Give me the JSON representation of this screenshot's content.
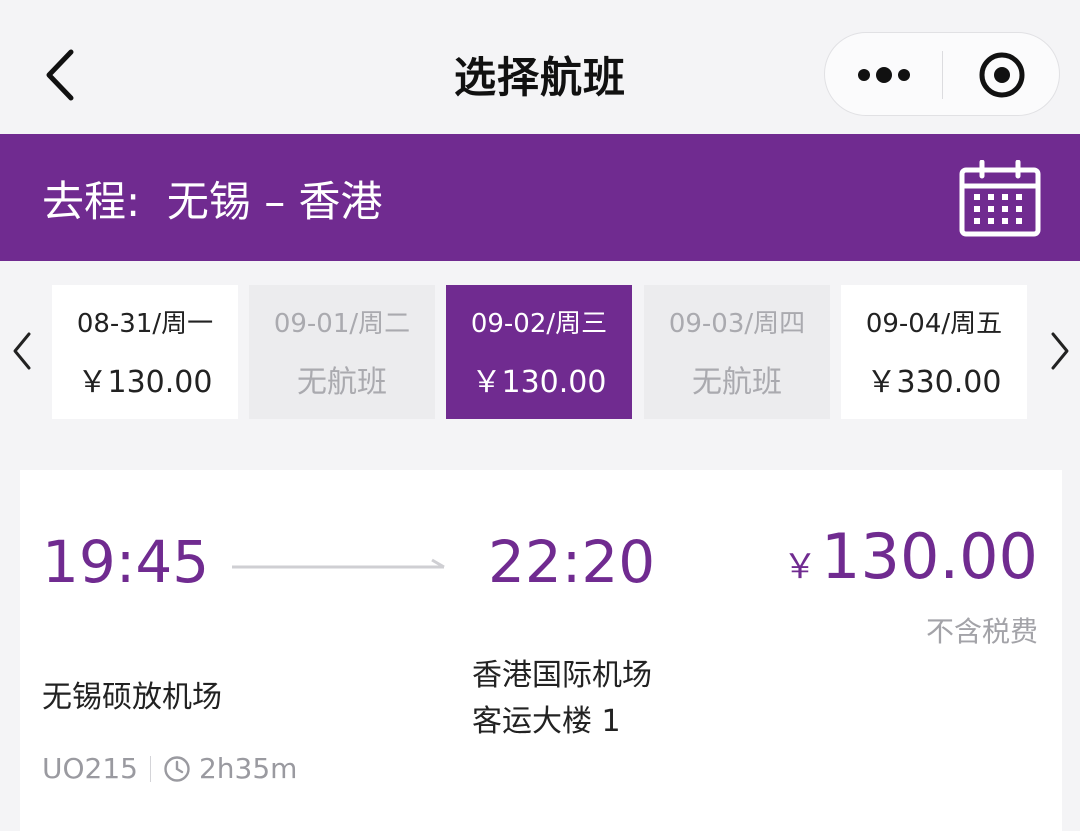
{
  "navbar": {
    "title": "选择航班",
    "back_icon": "chevron-left-icon",
    "more_icon": "more-dots-icon",
    "close_icon": "target-circle-icon"
  },
  "route": {
    "label": "去程:  无锡 – 香港",
    "calendar_icon": "calendar-icon"
  },
  "date_strip": {
    "prev_icon": "chevron-left-icon",
    "next_icon": "chevron-right-icon",
    "dates": [
      {
        "date": "08-31/周一",
        "price": "￥130.00",
        "state": "available"
      },
      {
        "date": "09-01/周二",
        "price": "无航班",
        "state": "disabled"
      },
      {
        "date": "09-02/周三",
        "price": "￥130.00",
        "state": "selected"
      },
      {
        "date": "09-03/周四",
        "price": "无航班",
        "state": "disabled"
      },
      {
        "date": "09-04/周五",
        "price": "￥330.00",
        "state": "available"
      }
    ]
  },
  "flight": {
    "departure_time": "19:45",
    "arrival_time": "22:20",
    "currency": "￥",
    "price": "130.00",
    "tax_note": "不含税费",
    "departure_airport": "无锡硕放机场",
    "arrival_airport": "香港国际机场",
    "arrival_terminal": "客运大楼 1",
    "flight_number": "UO215",
    "duration": "2h35m",
    "duration_icon": "clock-icon"
  },
  "colors": {
    "brand": "#702b90",
    "background": "#f4f4f6",
    "muted": "#a3a3a8"
  }
}
